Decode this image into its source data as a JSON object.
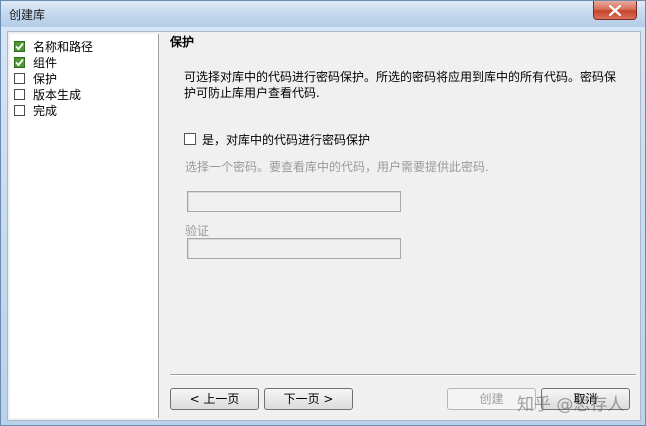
{
  "window": {
    "title": "创建库"
  },
  "tree": {
    "items": [
      {
        "label": "名称和路径",
        "checked": true
      },
      {
        "label": "组件",
        "checked": true
      },
      {
        "label": "保护",
        "checked": false
      },
      {
        "label": "版本生成",
        "checked": false
      },
      {
        "label": "完成",
        "checked": false
      }
    ]
  },
  "panel": {
    "title": "保护",
    "description": "可选择对库中的代码进行密码保护。所选的密码将应用到库中的所有代码。密码保护可防止库用户查看代码.",
    "protect_checkbox_label": "是，对库中的代码进行密码保护",
    "protect_checked": false,
    "password_hint": "选择一个密码。要查看库中的代码，用户需要提供此密码.",
    "password_value": "",
    "verify_label": "验证",
    "verify_value": ""
  },
  "buttons": {
    "prev": "< 上一页",
    "next": "下一页 >",
    "create": "创建",
    "cancel": "取消"
  },
  "watermark": "知乎 @思存人",
  "colors": {
    "check_green": "#4c9b2e",
    "close_red": "#c7432b",
    "disabled_text": "#9a9a9a"
  }
}
